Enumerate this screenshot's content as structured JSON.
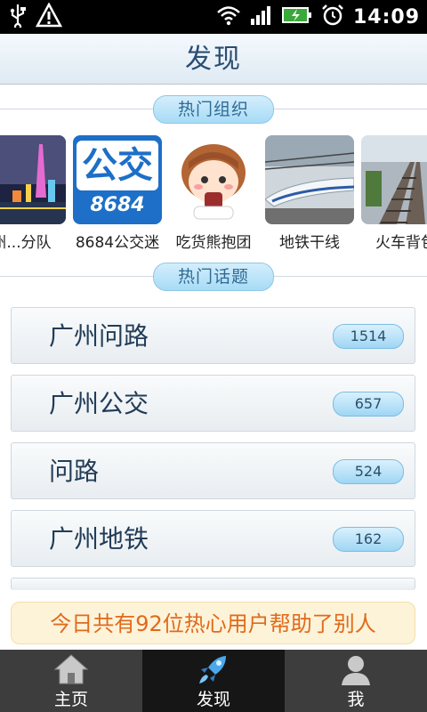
{
  "status_bar": {
    "time": "14:09",
    "icons": [
      "usb-icon",
      "warning-icon",
      "wifi-icon",
      "signal-icon",
      "battery-charging-icon",
      "alarm-icon"
    ]
  },
  "header": {
    "title": "发现"
  },
  "sections": {
    "groups_title": "热门组织",
    "topics_title": "热门话题"
  },
  "groups": [
    {
      "label": "州...分队",
      "image": "guangzhou-tower-night"
    },
    {
      "label": "8684公交迷",
      "image": "bus-logo"
    },
    {
      "label": "吃货熊抱团",
      "image": "cartoon-girl"
    },
    {
      "label": "地铁干线",
      "image": "high-speed-train"
    },
    {
      "label": "火车背包",
      "image": "railway-tracks"
    }
  ],
  "bus_logo": {
    "top_text": "公交",
    "bottom_text": "8684"
  },
  "topics": [
    {
      "name": "广州问路",
      "count": "1514"
    },
    {
      "name": "广州公交",
      "count": "657"
    },
    {
      "name": "问路",
      "count": "524"
    },
    {
      "name": "广州地铁",
      "count": "162"
    }
  ],
  "notice": "今日共有92位热心用户帮助了别人",
  "nav": {
    "home": "主页",
    "discover": "发现",
    "me": "我"
  },
  "colors": {
    "title_text": "#2a4e72",
    "pill_blue": "#a7dbf6",
    "notice_text": "#e06a1d",
    "nav_bg": "#3d3d3d",
    "nav_active": "#161616"
  }
}
